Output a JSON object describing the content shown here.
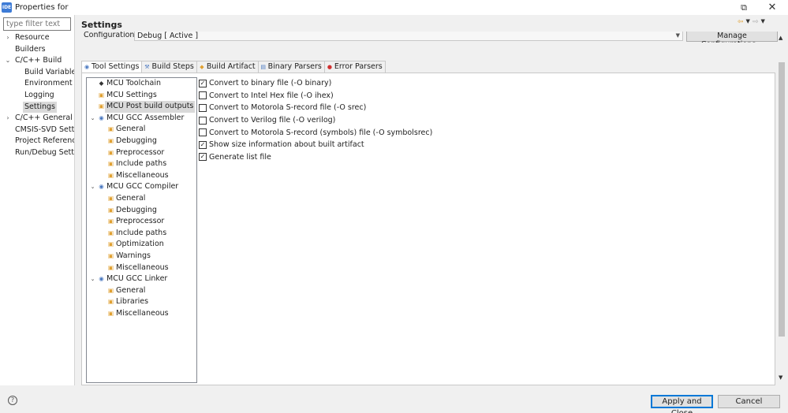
{
  "window": {
    "app_badge": "IDE",
    "title": "Properties for",
    "restore_glyph": "⧉",
    "close_glyph": "✕"
  },
  "filter": {
    "placeholder": "type filter text"
  },
  "nav": {
    "items": [
      {
        "label": "Resource",
        "twisty": "›",
        "indent": 1
      },
      {
        "label": "Builders",
        "twisty": "",
        "indent": 1
      },
      {
        "label": "C/C++ Build",
        "twisty": "⌄",
        "indent": 1
      },
      {
        "label": "Build Variables",
        "twisty": "",
        "indent": 2
      },
      {
        "label": "Environment",
        "twisty": "",
        "indent": 2
      },
      {
        "label": "Logging",
        "twisty": "",
        "indent": 2
      },
      {
        "label": "Settings",
        "twisty": "",
        "indent": 2,
        "selected": true
      },
      {
        "label": "C/C++ General",
        "twisty": "›",
        "indent": 1
      },
      {
        "label": "CMSIS-SVD Setti",
        "twisty": "",
        "indent": 1
      },
      {
        "label": "Project Reference:",
        "twisty": "",
        "indent": 1
      },
      {
        "label": "Run/Debug Settir",
        "twisty": "",
        "indent": 1
      }
    ]
  },
  "page": {
    "title": "Settings"
  },
  "configuration": {
    "label": "Configuration:",
    "value": "Debug  [ Active ]",
    "manage_button": "Manage Configurations..."
  },
  "tabs": [
    {
      "label": "Tool Settings",
      "icon": "gear-icon",
      "glyph": "◉",
      "active": true
    },
    {
      "label": "Build Steps",
      "icon": "wrench-icon",
      "glyph": "⚒",
      "active": false
    },
    {
      "label": "Build Artifact",
      "icon": "artifact-icon",
      "glyph": "◆",
      "active": false
    },
    {
      "label": "Binary Parsers",
      "icon": "binary-icon",
      "glyph": "▤",
      "active": false
    },
    {
      "label": "Error Parsers",
      "icon": "error-icon",
      "glyph": "●",
      "active": false
    }
  ],
  "tool_tree": [
    {
      "label": "MCU Toolchain",
      "level": 0,
      "twisty": "",
      "glyph": "◆",
      "icon": "toolchain-icon"
    },
    {
      "label": "MCU Settings",
      "level": 0,
      "twisty": "",
      "glyph": "▣",
      "icon": "settings-page-icon"
    },
    {
      "label": "MCU Post build outputs",
      "level": 0,
      "twisty": "",
      "glyph": "▣",
      "icon": "settings-page-icon",
      "selected": true
    },
    {
      "label": "MCU GCC Assembler",
      "level": 0,
      "twisty": "⌄",
      "glyph": "◉",
      "icon": "tool-icon"
    },
    {
      "label": "General",
      "level": 1,
      "twisty": "",
      "glyph": "▣",
      "icon": "settings-page-icon"
    },
    {
      "label": "Debugging",
      "level": 1,
      "twisty": "",
      "glyph": "▣",
      "icon": "settings-page-icon"
    },
    {
      "label": "Preprocessor",
      "level": 1,
      "twisty": "",
      "glyph": "▣",
      "icon": "settings-page-icon"
    },
    {
      "label": "Include paths",
      "level": 1,
      "twisty": "",
      "glyph": "▣",
      "icon": "settings-page-icon"
    },
    {
      "label": "Miscellaneous",
      "level": 1,
      "twisty": "",
      "glyph": "▣",
      "icon": "settings-page-icon"
    },
    {
      "label": "MCU GCC Compiler",
      "level": 0,
      "twisty": "⌄",
      "glyph": "◉",
      "icon": "tool-icon"
    },
    {
      "label": "General",
      "level": 1,
      "twisty": "",
      "glyph": "▣",
      "icon": "settings-page-icon"
    },
    {
      "label": "Debugging",
      "level": 1,
      "twisty": "",
      "glyph": "▣",
      "icon": "settings-page-icon"
    },
    {
      "label": "Preprocessor",
      "level": 1,
      "twisty": "",
      "glyph": "▣",
      "icon": "settings-page-icon"
    },
    {
      "label": "Include paths",
      "level": 1,
      "twisty": "",
      "glyph": "▣",
      "icon": "settings-page-icon"
    },
    {
      "label": "Optimization",
      "level": 1,
      "twisty": "",
      "glyph": "▣",
      "icon": "settings-page-icon"
    },
    {
      "label": "Warnings",
      "level": 1,
      "twisty": "",
      "glyph": "▣",
      "icon": "settings-page-icon"
    },
    {
      "label": "Miscellaneous",
      "level": 1,
      "twisty": "",
      "glyph": "▣",
      "icon": "settings-page-icon"
    },
    {
      "label": "MCU GCC Linker",
      "level": 0,
      "twisty": "⌄",
      "glyph": "◉",
      "icon": "tool-icon"
    },
    {
      "label": "General",
      "level": 1,
      "twisty": "",
      "glyph": "▣",
      "icon": "settings-page-icon"
    },
    {
      "label": "Libraries",
      "level": 1,
      "twisty": "",
      "glyph": "▣",
      "icon": "settings-page-icon"
    },
    {
      "label": "Miscellaneous",
      "level": 1,
      "twisty": "",
      "glyph": "▣",
      "icon": "settings-page-icon"
    }
  ],
  "options": [
    {
      "label": "Convert to binary file (-O binary)",
      "checked": true
    },
    {
      "label": "Convert to Intel Hex file (-O ihex)",
      "checked": false
    },
    {
      "label": "Convert to Motorola S-record file (-O srec)",
      "checked": false
    },
    {
      "label": "Convert to Verilog file (-O verilog)",
      "checked": false
    },
    {
      "label": "Convert to Motorola S-record (symbols) file (-O symbolsrec)",
      "checked": false
    },
    {
      "label": "Show size information about built artifact",
      "checked": true
    },
    {
      "label": "Generate list file",
      "checked": true
    }
  ],
  "footer": {
    "help": "?",
    "apply_button": "Apply and Close",
    "cancel_button": "Cancel"
  },
  "colors": {
    "selection": "#d9d9d9",
    "default_button_border": "#0078d7",
    "app_icon": "#3d7bd6",
    "icon_orange": "#e0a030",
    "icon_blue": "#4a78c0",
    "icon_red": "#d03030"
  }
}
